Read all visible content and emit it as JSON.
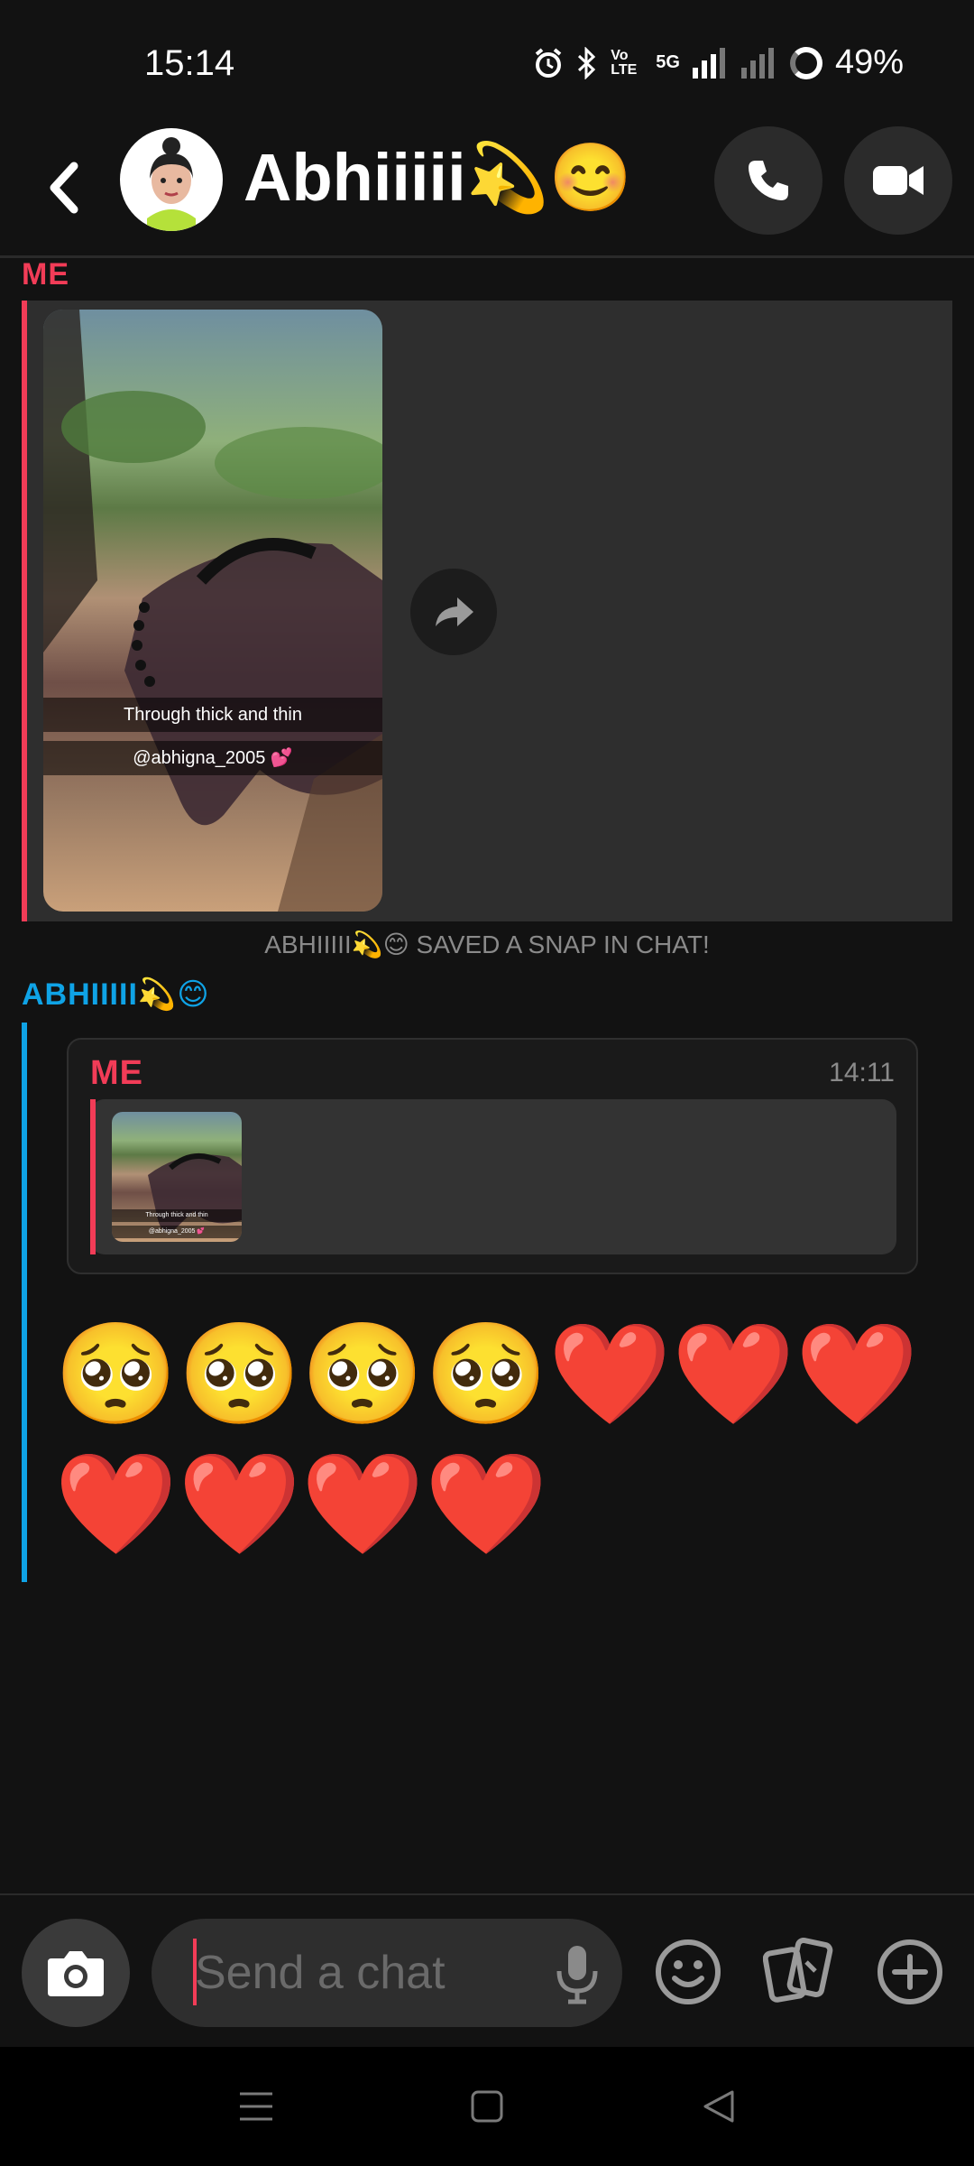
{
  "status_bar": {
    "time": "15:14",
    "signal_label": "Vo LTE",
    "network": "5G",
    "battery": "49%"
  },
  "header": {
    "contact_name": "Abhiiiii💫😊",
    "icons": {
      "back": "back-chevron-icon",
      "call": "phone-icon",
      "video": "video-camera-icon"
    }
  },
  "messages": {
    "me_label_1": "ME",
    "snap_caption_1": "Through thick and thin",
    "snap_caption_2": "@abhigna_2005 💕",
    "saved_note": "ABHIIIII💫😊 SAVED A SNAP IN CHAT!",
    "friend_label": "ABHIIIII💫😊",
    "reply_sender": "ME",
    "reply_time": "14:11",
    "reply_mini_caption_1": "Through thick and thin",
    "reply_mini_caption_2": "@abhigna_2005 💕",
    "emoji_line_1": "🥺🥺🥺🥺❤️❤️❤️",
    "emoji_line_2": "❤️❤️❤️❤️"
  },
  "composer": {
    "placeholder": "Send a chat"
  },
  "colors": {
    "me_accent": "#f23c57",
    "friend_accent": "#0fa3e6",
    "background": "#121212"
  }
}
